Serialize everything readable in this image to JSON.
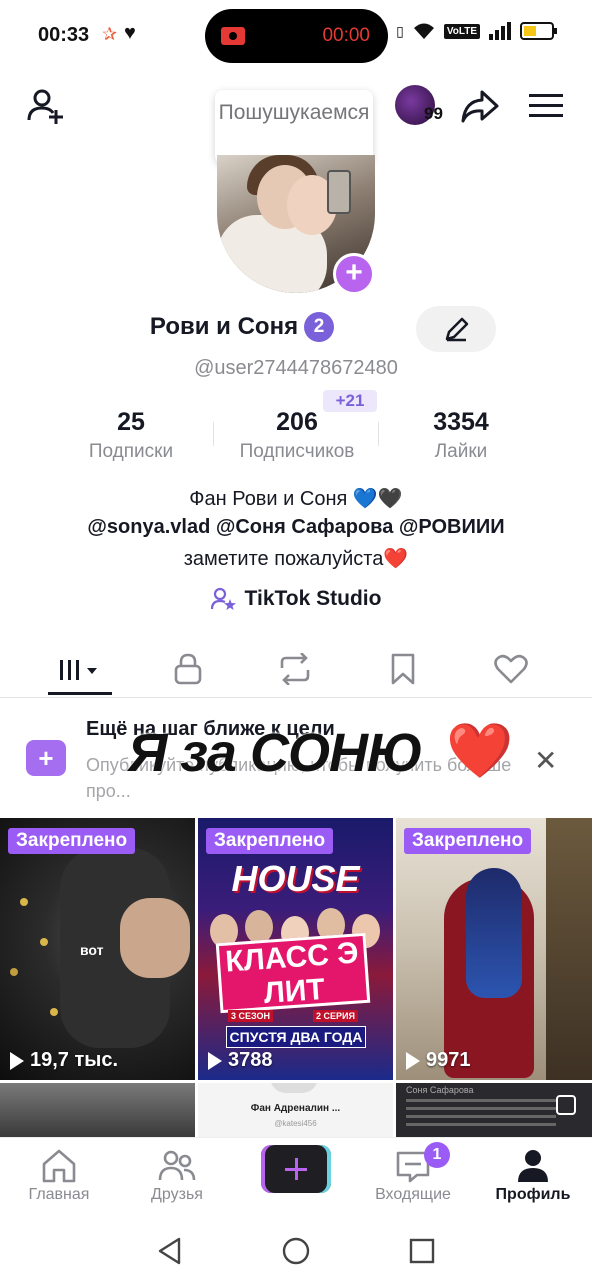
{
  "status_bar": {
    "time": "00:33",
    "record_time": "00:00",
    "network": "VoLTE"
  },
  "header": {
    "tooltip": "Пошушукаемся",
    "friends_count": "99"
  },
  "profile": {
    "name": "Рови и Соня",
    "badge": "2",
    "username": "@user2744478672480",
    "stats": [
      {
        "value": "25",
        "label": "Подписки"
      },
      {
        "value": "206",
        "label": "Подписчиков"
      },
      {
        "value": "3354",
        "label": "Лайки"
      }
    ],
    "new_followers": "+21",
    "bio_line1": "Фан Рови и Соня 💙🖤",
    "bio_line2": "@sonya.vlad @Соня Сафарова @РОВИИИ",
    "bio_line3": "заметите пожалуйста❤️",
    "studio_link": "TikTok Studio"
  },
  "banner": {
    "title": "Ещё на шаг ближе к цели",
    "subtitle": "Опубликуйте публикацию, чтобы получить больше про...",
    "overlay_text": "Я за СОНЮ",
    "overlay_emoji": "❤️"
  },
  "videos": [
    {
      "pinned": "Закреплено",
      "views": "19,7 тыс.",
      "caption": "вот"
    },
    {
      "pinned": "Закреплено",
      "views": "3788",
      "caption": "HOUSE",
      "title": "КЛАСС ЭЛИТ",
      "season": "3 СЕЗОН",
      "episode": "2 СЕРИЯ",
      "subtitle": "СПУСТЯ ДВА ГОДА"
    },
    {
      "pinned": "Закреплено",
      "views": "9971"
    }
  ],
  "row2": {
    "middle_name": "Фан Адреналин ...",
    "middle_user": "@katesi456",
    "right_author": "Соня Сафарова"
  },
  "bottom_nav": {
    "home": "Главная",
    "friends": "Друзья",
    "inbox": "Входящие",
    "inbox_badge": "1",
    "profile": "Профиль"
  }
}
